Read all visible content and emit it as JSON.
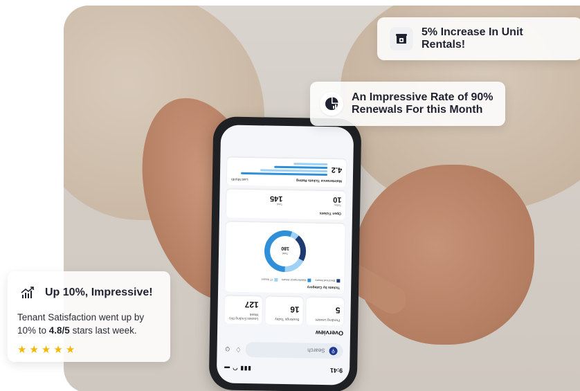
{
  "cards": {
    "top": {
      "title": "5% Increase In Unit Rentals!",
      "icon": "store-icon"
    },
    "middle": {
      "title_line1": "An Impressive Rate of  90%",
      "title_line2": "Renewals For this Month",
      "icon": "pie-chart-icon"
    },
    "left": {
      "title": "Up 10%, Impressive!",
      "icon": "growth-chart-icon",
      "body_prefix": "Tenant Satisfaction went up by 10% to ",
      "body_bold": "4.8/5",
      "body_suffix": " stars last week.",
      "rating_stars": 5
    }
  },
  "phone": {
    "status_time": "9:41",
    "search_placeholder": "Search",
    "overview_title": "Overview",
    "stats": [
      {
        "label": "Pending Leases",
        "value": "5"
      },
      {
        "label": "Bookings Today",
        "value": "16"
      },
      {
        "label": "Leases Ending this Week",
        "value": "127"
      }
    ],
    "category_card": {
      "title": "Tickets by Category",
      "legend": [
        "Electrical Issues",
        "Maintenance Issues",
        "IT Issues"
      ],
      "total_label": "Total",
      "total_value": "180"
    },
    "open_tickets": {
      "title": "Open Tickets",
      "today_label": "Today",
      "today_value": "10",
      "total_label": "Total",
      "total_value": "145"
    },
    "rating_card": {
      "title": "Maintenance Tickets Rating",
      "period": "Last Month",
      "value": "4.2"
    }
  },
  "colors": {
    "accent": "#1f3a93",
    "donut_dark": "#1e3a6e",
    "donut_mid": "#2f8fd8",
    "donut_light": "#9fd0f5",
    "star": "#f5b800"
  }
}
